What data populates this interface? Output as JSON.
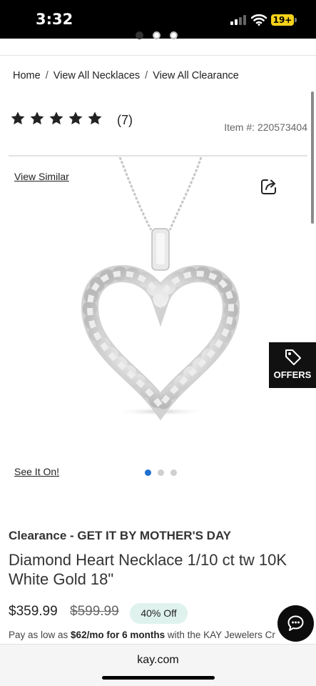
{
  "status_bar": {
    "time": "3:32",
    "battery": "19+"
  },
  "breadcrumb": [
    {
      "label": "Home"
    },
    {
      "label": "View All Necklaces"
    },
    {
      "label": "View All Clearance"
    }
  ],
  "rating": {
    "stars": 5,
    "review_count": "(7)"
  },
  "item_number": "Item #: 220573404",
  "links": {
    "view_similar": "View Similar",
    "see_it_on": "See It On!"
  },
  "offers": {
    "label": "OFFERS"
  },
  "product": {
    "promo": "Clearance - GET IT BY MOTHER'S DAY",
    "title": "Diamond Heart Necklace 1/10 ct tw 10K White Gold 18\"",
    "price": "$359.99",
    "original_price": "$599.99",
    "discount": "40% Off",
    "financing": {
      "prefix": "Pay as low as ",
      "amount": "$62/mo for 6 months",
      "suffix": " with the KAY Jewelers Cr"
    }
  },
  "image_gallery": {
    "count": 3,
    "active_index": 0
  },
  "browser": {
    "url": "kay.com"
  },
  "colors": {
    "active_dot": "#1f6fd1",
    "discount_badge": "#dff2ee",
    "offers_bg": "#111111"
  }
}
